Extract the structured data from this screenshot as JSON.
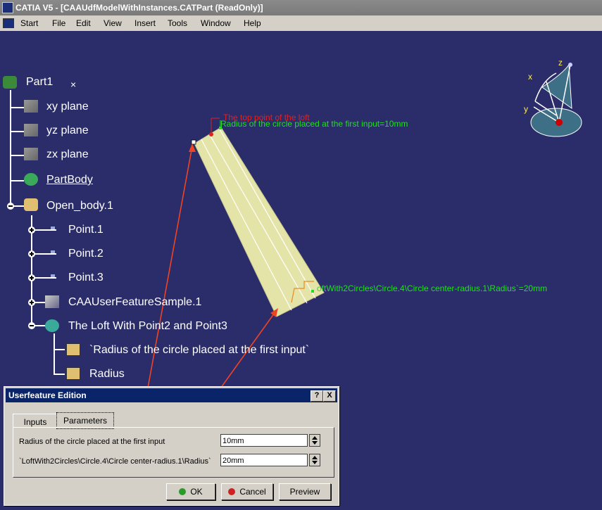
{
  "window": {
    "title": "CATIA V5 - [CAAUdfModelWithInstances.CATPart (ReadOnly)]"
  },
  "menu": {
    "start": "Start",
    "file": "File",
    "edit": "Edit",
    "view": "View",
    "insert": "Insert",
    "tools": "Tools",
    "window": "Window",
    "help": "Help"
  },
  "tree": {
    "part": "Part1",
    "close_glyph": "×",
    "xy_plane": "xy plane",
    "yz_plane": "yz plane",
    "zx_plane": "zx plane",
    "part_body": "PartBody",
    "open_body": "Open_body.1",
    "point1": "Point.1",
    "point2": "Point.2",
    "point3": "Point.3",
    "user_feature": "CAAUserFeatureSample.1",
    "loft": "The Loft With Point2 and Point3",
    "param_radius_first": "`Radius of the circle placed at the first input`",
    "param_radius": "Radius"
  },
  "annotations": {
    "top_point": "The top point of the loft",
    "radius_first": "Radius of the circle placed at the first input=10mm",
    "radius_second": "oftWith2Circles\\Circle.4\\Circle center-radius.1\\Radius`=20mm"
  },
  "compass": {
    "x": "x",
    "y": "y",
    "z": "z"
  },
  "dialog": {
    "title": "Userfeature Edition",
    "help_btn": "?",
    "close_btn": "X",
    "tab_inputs": "Inputs",
    "tab_parameters": "Parameters",
    "row1_label": "Radius of the circle placed at the first input",
    "row1_value": "10mm",
    "row2_label": "`LoftWith2Circles\\Circle.4\\Circle center-radius.1\\Radius`",
    "row2_value": "20mm",
    "ok": "OK",
    "cancel": "Cancel",
    "preview": "Preview"
  },
  "colors": {
    "background": "#2b2c6a",
    "surface": "#e6e6aa",
    "annotation_green": "#22dd22",
    "annotation_red": "#dd2222",
    "arrow": "#ee4422"
  }
}
